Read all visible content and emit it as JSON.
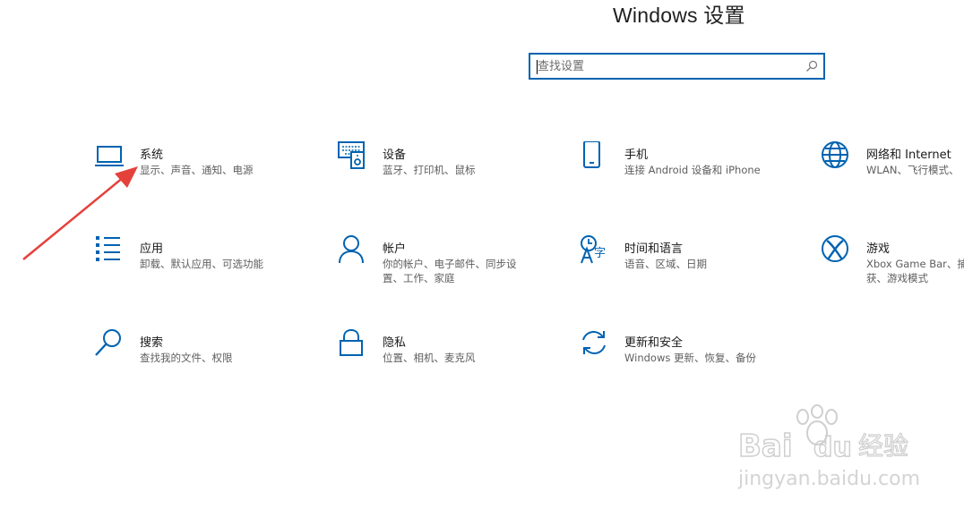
{
  "header": {
    "title": "Windows 设置"
  },
  "search": {
    "placeholder": "查找设置"
  },
  "tiles": [
    {
      "name": "系统",
      "desc": "显示、声音、通知、电源",
      "icon": "laptop-icon"
    },
    {
      "name": "设备",
      "desc": "蓝牙、打印机、鼠标",
      "icon": "devices-icon"
    },
    {
      "name": "手机",
      "desc": "连接 Android 设备和 iPhone",
      "icon": "phone-icon"
    },
    {
      "name": "网络和 Internet",
      "desc": "WLAN、飞行模式、",
      "icon": "globe-icon"
    },
    {
      "name": "应用",
      "desc": "卸载、默认应用、可选功能",
      "icon": "apps-list-icon"
    },
    {
      "name": "帐户",
      "desc": "你的帐户、电子邮件、同步设置、工作、家庭",
      "icon": "person-icon"
    },
    {
      "name": "时间和语言",
      "desc": "语音、区域、日期",
      "icon": "time-language-icon"
    },
    {
      "name": "游戏",
      "desc": "Xbox Game Bar、捕获、游戏模式",
      "icon": "xbox-icon"
    },
    {
      "name": "搜索",
      "desc": "查找我的文件、权限",
      "icon": "search-magnifier-icon"
    },
    {
      "name": "隐私",
      "desc": "位置、相机、麦克风",
      "icon": "lock-icon"
    },
    {
      "name": "更新和安全",
      "desc": "Windows 更新、恢复、备份",
      "icon": "sync-icon"
    }
  ],
  "watermark": {
    "brand": "Bai du 经验",
    "site": "jingyan.baidu.com"
  },
  "colors": {
    "accent": "#0063b1",
    "icon": "#0063b1",
    "annotation_arrow": "#e5413b"
  }
}
